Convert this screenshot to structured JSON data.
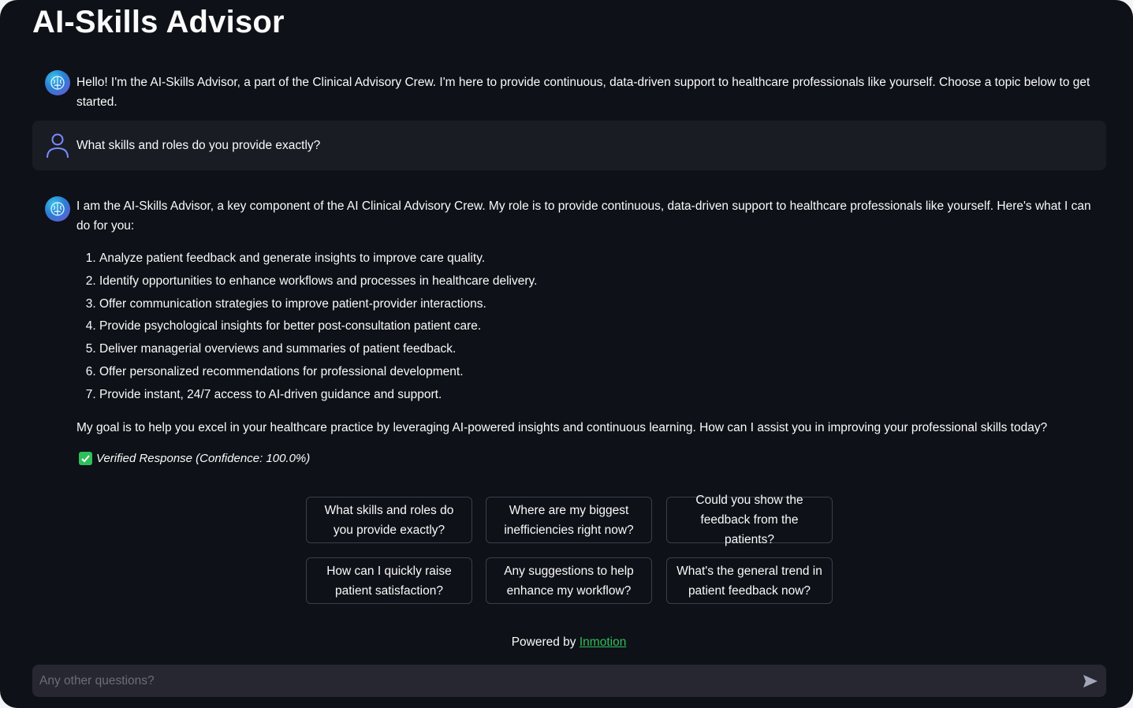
{
  "app": {
    "title": "AI-Skills Advisor"
  },
  "messages": {
    "greeting": "Hello! I'm the AI-Skills Advisor, a part of the Clinical Advisory Crew. I'm here to provide continuous, data-driven support to healthcare professionals like yourself. Choose a topic below to get started.",
    "user_question": "What skills and roles do you provide exactly?",
    "answer_intro": "I am the AI-Skills Advisor, a key component of the AI Clinical Advisory Crew. My role is to provide continuous, data-driven support to healthcare professionals like yourself. Here's what I can do for you:",
    "capabilities": [
      "Analyze patient feedback and generate insights to improve care quality.",
      "Identify opportunities to enhance workflows and processes in healthcare delivery.",
      "Offer communication strategies to improve patient-provider interactions.",
      "Provide psychological insights for better post-consultation patient care.",
      "Deliver managerial overviews and summaries of patient feedback.",
      "Offer personalized recommendations for professional development.",
      "Provide instant, 24/7 access to AI-driven guidance and support."
    ],
    "answer_outro": "My goal is to help you excel in your healthcare practice by leveraging AI-powered insights and continuous learning. How can I assist you in improving your professional skills today?",
    "verified": "Verified Response (Confidence: 100.0%)"
  },
  "suggestions": [
    "What skills and roles do you provide exactly?",
    "Where are my biggest inefficiencies right now?",
    "Could you show the feedback from the patients?",
    "How can I quickly raise patient satisfaction?",
    "Any suggestions to help enhance my workflow?",
    "What's the general trend in patient feedback now?"
  ],
  "footer": {
    "powered_prefix": "Powered by",
    "powered_link": "Inmotion"
  },
  "input": {
    "placeholder": "Any other questions?",
    "value": ""
  },
  "icons": {
    "bot": "brain-avatar-icon",
    "user": "user-avatar-icon",
    "verified": "check-box-icon",
    "send": "send-arrow-icon"
  },
  "colors": {
    "background": "#0e1117",
    "user_message_bg": "#1a1c24",
    "input_bg": "#262730",
    "accent_green": "#2fbf5a",
    "text": "#fafafa"
  }
}
